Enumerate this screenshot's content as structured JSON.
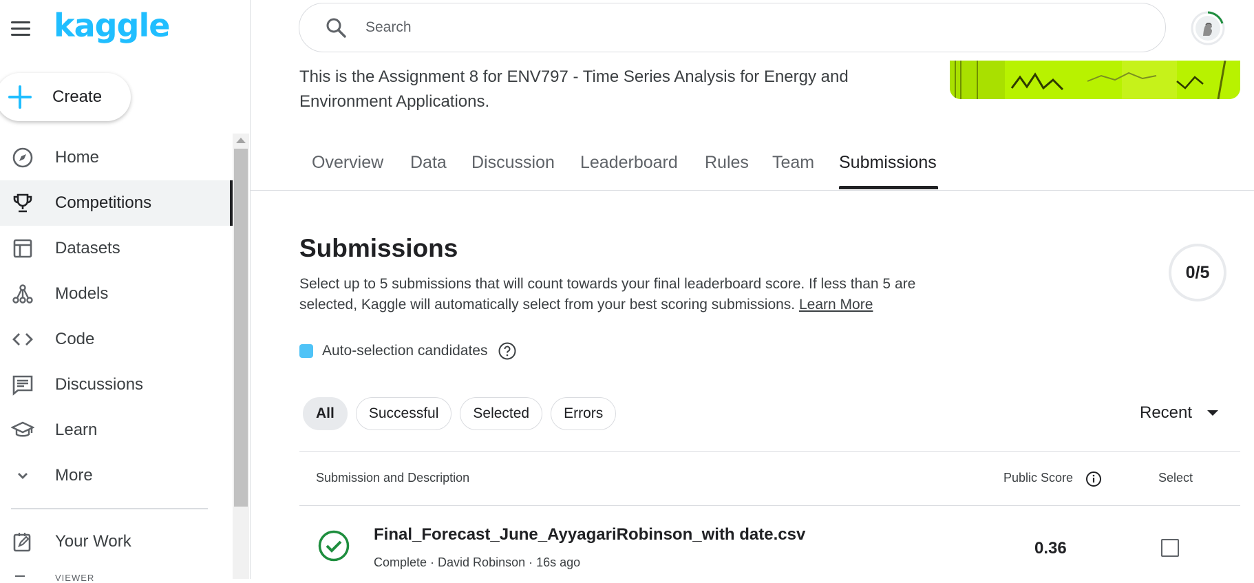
{
  "brand": {
    "logo_text": "kaggle",
    "accent": "#20beff"
  },
  "sidebar": {
    "create_label": "Create",
    "items": [
      {
        "label": "Home",
        "icon": "compass-icon",
        "active": false
      },
      {
        "label": "Competitions",
        "icon": "trophy-icon",
        "active": true
      },
      {
        "label": "Datasets",
        "icon": "table-icon",
        "active": false
      },
      {
        "label": "Models",
        "icon": "models-icon",
        "active": false
      },
      {
        "label": "Code",
        "icon": "code-icon",
        "active": false
      },
      {
        "label": "Discussions",
        "icon": "discussions-icon",
        "active": false
      },
      {
        "label": "Learn",
        "icon": "graduation-cap-icon",
        "active": false
      },
      {
        "label": "More",
        "icon": "chevron-down-icon",
        "active": false
      }
    ],
    "your_work_label": "Your Work",
    "viewer_label": "VIEWER"
  },
  "header": {
    "search_placeholder": "Search"
  },
  "competition": {
    "description": "This is the Assignment 8 for ENV797 - Time Series Analysis for Energy and Environment Applications."
  },
  "tabs": [
    {
      "label": "Overview",
      "active": false
    },
    {
      "label": "Data",
      "active": false
    },
    {
      "label": "Discussion",
      "active": false
    },
    {
      "label": "Leaderboard",
      "active": false
    },
    {
      "label": "Rules",
      "active": false
    },
    {
      "label": "Team",
      "active": false
    },
    {
      "label": "Submissions",
      "active": true
    }
  ],
  "submissions": {
    "title": "Submissions",
    "description": "Select up to 5 submissions that will count towards your final leaderboard score. If less than 5 are selected, Kaggle will automatically select from your best scoring submissions.",
    "learn_more": "Learn More",
    "counter": "0/5",
    "legend_label": "Auto-selection candidates",
    "legend_color": "#4fc3f7",
    "filters": [
      {
        "label": "All",
        "active": true
      },
      {
        "label": "Successful",
        "active": false
      },
      {
        "label": "Selected",
        "active": false
      },
      {
        "label": "Errors",
        "active": false
      }
    ],
    "sort_label": "Recent",
    "columns": {
      "submission": "Submission and Description",
      "public_score": "Public Score",
      "select": "Select"
    },
    "rows": [
      {
        "file_name": "Final_Forecast_June_AyyagariRobinson_with date.csv",
        "status": "Complete",
        "author": "David Robinson",
        "time": "16s ago",
        "meta": "Complete · David Robinson · 16s ago",
        "score": "0.36",
        "status_color": "#1e8e3e",
        "selected": false
      }
    ]
  }
}
